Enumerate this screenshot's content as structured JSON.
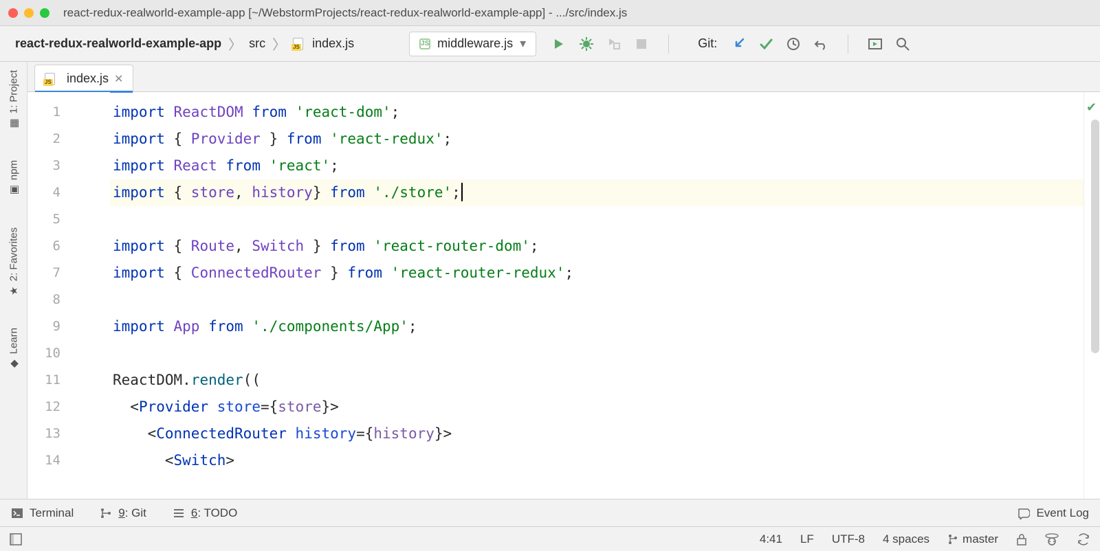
{
  "titlebar": {
    "title": "react-redux-realworld-example-app [~/WebstormProjects/react-redux-realworld-example-app] - .../src/index.js"
  },
  "breadcrumbs": {
    "project": "react-redux-realworld-example-app",
    "folder": "src",
    "file": "index.js"
  },
  "runConfig": {
    "selected": "middleware.js"
  },
  "git": {
    "label": "Git:"
  },
  "tabs": {
    "active": "index.js"
  },
  "leftbar": {
    "project": "1: Project",
    "npm": "npm",
    "favorites": "2: Favorites",
    "learn": "Learn"
  },
  "code": {
    "lines": [
      [
        {
          "t": "import",
          "c": "kw"
        },
        {
          "t": " "
        },
        {
          "t": "ReactDOM",
          "c": "id"
        },
        {
          "t": " "
        },
        {
          "t": "from",
          "c": "kw"
        },
        {
          "t": " "
        },
        {
          "t": "'react-dom'",
          "c": "str"
        },
        {
          "t": ";"
        }
      ],
      [
        {
          "t": "import",
          "c": "kw"
        },
        {
          "t": " { "
        },
        {
          "t": "Provider",
          "c": "id"
        },
        {
          "t": " } "
        },
        {
          "t": "from",
          "c": "kw"
        },
        {
          "t": " "
        },
        {
          "t": "'react-redux'",
          "c": "str"
        },
        {
          "t": ";"
        }
      ],
      [
        {
          "t": "import",
          "c": "kw"
        },
        {
          "t": " "
        },
        {
          "t": "React",
          "c": "id"
        },
        {
          "t": " "
        },
        {
          "t": "from",
          "c": "kw"
        },
        {
          "t": " "
        },
        {
          "t": "'react'",
          "c": "str"
        },
        {
          "t": ";"
        }
      ],
      [
        {
          "t": "import",
          "c": "kw"
        },
        {
          "t": " { "
        },
        {
          "t": "store",
          "c": "id"
        },
        {
          "t": ", "
        },
        {
          "t": "history",
          "c": "id"
        },
        {
          "t": "} "
        },
        {
          "t": "from",
          "c": "kw"
        },
        {
          "t": " "
        },
        {
          "t": "'./store'",
          "c": "str"
        },
        {
          "t": ";"
        }
      ],
      [],
      [
        {
          "t": "import",
          "c": "kw"
        },
        {
          "t": " { "
        },
        {
          "t": "Route",
          "c": "id"
        },
        {
          "t": ", "
        },
        {
          "t": "Switch",
          "c": "id"
        },
        {
          "t": " } "
        },
        {
          "t": "from",
          "c": "kw"
        },
        {
          "t": " "
        },
        {
          "t": "'react-router-dom'",
          "c": "str"
        },
        {
          "t": ";"
        }
      ],
      [
        {
          "t": "import",
          "c": "kw"
        },
        {
          "t": " { "
        },
        {
          "t": "ConnectedRouter",
          "c": "id"
        },
        {
          "t": " } "
        },
        {
          "t": "from",
          "c": "kw"
        },
        {
          "t": " "
        },
        {
          "t": "'react-router-redux'",
          "c": "str"
        },
        {
          "t": ";"
        }
      ],
      [],
      [
        {
          "t": "import",
          "c": "kw"
        },
        {
          "t": " "
        },
        {
          "t": "App",
          "c": "id"
        },
        {
          "t": " "
        },
        {
          "t": "from",
          "c": "kw"
        },
        {
          "t": " "
        },
        {
          "t": "'./components/App'",
          "c": "str"
        },
        {
          "t": ";"
        }
      ],
      [],
      [
        {
          "t": "ReactDOM"
        },
        {
          "t": ".",
          "c": "txt"
        },
        {
          "t": "render",
          "c": "fn"
        },
        {
          "t": "(("
        }
      ],
      [
        {
          "t": "  "
        },
        {
          "t": "<",
          "c": "txt"
        },
        {
          "t": "Provider",
          "c": "tag"
        },
        {
          "t": " "
        },
        {
          "t": "store",
          "c": "attr"
        },
        {
          "t": "="
        },
        {
          "t": "{"
        },
        {
          "t": "store",
          "c": "id2"
        },
        {
          "t": "}"
        },
        {
          "t": ">",
          "c": "txt"
        }
      ],
      [
        {
          "t": "    "
        },
        {
          "t": "<",
          "c": "txt"
        },
        {
          "t": "ConnectedRouter",
          "c": "tag"
        },
        {
          "t": " "
        },
        {
          "t": "history",
          "c": "attr"
        },
        {
          "t": "="
        },
        {
          "t": "{"
        },
        {
          "t": "history",
          "c": "id2"
        },
        {
          "t": "}"
        },
        {
          "t": ">",
          "c": "txt"
        }
      ],
      [
        {
          "t": "      "
        },
        {
          "t": "<",
          "c": "txt"
        },
        {
          "t": "Switch",
          "c": "tag"
        },
        {
          "t": ">",
          "c": "txt"
        }
      ]
    ],
    "highlightLine": 4,
    "cursorLine": 4
  },
  "bottombar": {
    "terminal": "Terminal",
    "git": "9: Git",
    "gitU": "9",
    "todo": "6: TODO",
    "todoU": "6",
    "eventLog": "Event Log"
  },
  "statusbar": {
    "pos": "4:41",
    "lineEnding": "LF",
    "encoding": "UTF-8",
    "indent": "4 spaces",
    "branch": "master"
  }
}
